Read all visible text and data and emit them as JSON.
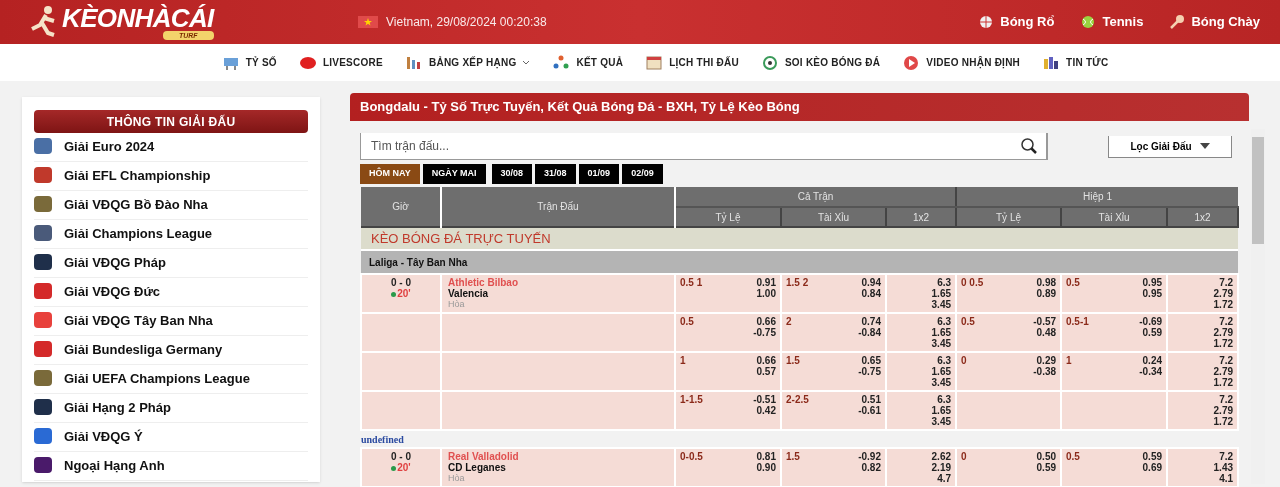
{
  "header": {
    "logo": "KÈONHÀCÁI",
    "logo_badge": "TURF",
    "locale": "Vietnam, 29/08/2024 00:20:38",
    "sports": [
      {
        "label": "Bóng Rổ",
        "kind": "basketball"
      },
      {
        "label": "Tennis",
        "kind": "tennis"
      },
      {
        "label": "Bóng Chày",
        "kind": "baseball"
      }
    ]
  },
  "nav": [
    {
      "label": "TỶ SỐ",
      "kind": "score",
      "dropdown": false
    },
    {
      "label": "LIVESCORE",
      "kind": "live",
      "dropdown": false
    },
    {
      "label": "BẢNG XẾP HẠNG",
      "kind": "ranking",
      "dropdown": true
    },
    {
      "label": "KẾT QUẢ",
      "kind": "result",
      "dropdown": false
    },
    {
      "label": "LỊCH THI ĐẤU",
      "kind": "calendar",
      "dropdown": false
    },
    {
      "label": "SOI KÈO BÓNG ĐÁ",
      "kind": "ball",
      "dropdown": false
    },
    {
      "label": "VIDEO NHẬN ĐỊNH",
      "kind": "video",
      "dropdown": false
    },
    {
      "label": "TIN TỨC",
      "kind": "news",
      "dropdown": false
    }
  ],
  "sidebar": {
    "title": "THÔNG TIN GIẢI ĐẤU",
    "items": [
      {
        "label": "Giải Euro 2024",
        "color": "#4a6fa5"
      },
      {
        "label": "Giải EFL Championship",
        "color": "#c0392b"
      },
      {
        "label": "Giải VĐQG Bồ Đào Nha",
        "color": "#7a6a3a"
      },
      {
        "label": "Giải Champions League",
        "color": "#4a5a7a"
      },
      {
        "label": "Giải VĐQG Pháp",
        "color": "#1f2f4a"
      },
      {
        "label": "Giải VĐQG Đức",
        "color": "#d42a2a"
      },
      {
        "label": "Giải VĐQG Tây Ban Nha",
        "color": "#e8413c"
      },
      {
        "label": "Giải Bundesliga Germany",
        "color": "#d42a2a"
      },
      {
        "label": "Giải UEFA Champions League",
        "color": "#7a6a3a"
      },
      {
        "label": "Giải Hạng 2 Pháp",
        "color": "#1f2f4a"
      },
      {
        "label": "Giải VĐQG Ý",
        "color": "#2a6ad4"
      },
      {
        "label": "Ngoại Hạng Anh",
        "color": "#4a1a6a"
      }
    ]
  },
  "main": {
    "title": "Bongdalu - Tỷ Số Trực Tuyến, Kết Quả Bóng Đá - BXH, Tỷ Lệ Kèo Bóng",
    "search": {
      "placeholder": "Tìm trận đấu..."
    },
    "filter": "Lọc Giải Đấu",
    "date_tabs": [
      {
        "label": "HÔM NAY",
        "selected": true
      },
      {
        "label": "NGÀY MAI",
        "selected": false
      },
      {
        "label": "30/08",
        "selected": false
      },
      {
        "label": "31/08",
        "selected": false
      },
      {
        "label": "01/09",
        "selected": false
      },
      {
        "label": "02/09",
        "selected": false
      }
    ],
    "table": {
      "col_time": "Giờ",
      "col_match": "Trận Đấu",
      "groups": [
        {
          "label": "Cả Trận",
          "columns": [
            "Tỷ Lệ",
            "Tài Xỉu",
            "1x2"
          ]
        },
        {
          "label": "Hiệp 1",
          "columns": [
            "Tỷ Lệ",
            "Tài Xỉu",
            "1x2"
          ]
        }
      ],
      "section": "KÈO BÓNG ĐÁ TRỰC TUYẾN",
      "blocks": [
        {
          "kind": "league",
          "label": "Laliga - Tây Ban Nha"
        },
        {
          "kind": "match",
          "score": "0 - 0",
          "minute": "20'",
          "home": "Athletic Bilbao",
          "away": "Valencia",
          "note": "Hòa",
          "rows": [
            [
              {
                "line": "0.5 1",
                "odds": [
                  "0.91",
                  "1.00"
                ]
              },
              {
                "line": "1.5 2",
                "odds": [
                  "0.94",
                  "0.84"
                ]
              },
              {
                "odds": [
                  "6.3",
                  "1.65",
                  "3.45"
                ]
              },
              {
                "line": "0 0.5",
                "odds": [
                  "0.98",
                  "0.89"
                ]
              },
              {
                "line": "0.5",
                "odds": [
                  "0.95",
                  "0.95"
                ]
              },
              {
                "odds": [
                  "7.2",
                  "2.79",
                  "1.72"
                ]
              }
            ],
            [
              {
                "line": "0.5",
                "odds": [
                  "0.66",
                  "-0.75"
                ]
              },
              {
                "line": "2",
                "odds": [
                  "0.74",
                  "-0.84"
                ]
              },
              {
                "odds": [
                  "6.3",
                  "1.65",
                  "3.45"
                ]
              },
              {
                "line": "0.5",
                "odds": [
                  "-0.57",
                  "0.48"
                ]
              },
              {
                "line": "0.5-1",
                "odds": [
                  "-0.69",
                  "0.59"
                ]
              },
              {
                "odds": [
                  "7.2",
                  "2.79",
                  "1.72"
                ]
              }
            ],
            [
              {
                "line": "1",
                "odds": [
                  "0.66",
                  "0.57"
                ]
              },
              {
                "line": "1.5",
                "odds": [
                  "0.65",
                  "-0.75"
                ]
              },
              {
                "odds": [
                  "6.3",
                  "1.65",
                  "3.45"
                ]
              },
              {
                "line": "0",
                "odds": [
                  "0.29",
                  "-0.38"
                ]
              },
              {
                "line": "1",
                "odds": [
                  "0.24",
                  "-0.34"
                ]
              },
              {
                "odds": [
                  "7.2",
                  "2.79",
                  "1.72"
                ]
              }
            ],
            [
              {
                "line": "1-1.5",
                "odds": [
                  "-0.51",
                  "0.42"
                ]
              },
              {
                "line": "2-2.5",
                "odds": [
                  "0.51",
                  "-0.61"
                ]
              },
              {
                "odds": [
                  "6.3",
                  "1.65",
                  "3.45"
                ]
              },
              {},
              {},
              {
                "odds": [
                  "7.2",
                  "2.79",
                  "1.72"
                ]
              }
            ]
          ]
        },
        {
          "kind": "label",
          "label": "undefined"
        },
        {
          "kind": "match",
          "score": "0 - 0",
          "minute": "20'",
          "home": "Real Valladolid",
          "away": "CD Leganes",
          "note": "Hòa",
          "rows": [
            [
              {
                "line": "0-0.5",
                "odds": [
                  "0.81",
                  "0.90"
                ]
              },
              {
                "line": "1.5",
                "odds": [
                  "-0.92",
                  "0.82"
                ]
              },
              {
                "odds": [
                  "2.62",
                  "2.19",
                  "4.7"
                ]
              },
              {
                "line": "0",
                "odds": [
                  "0.50",
                  "0.59"
                ]
              },
              {
                "line": "0.5",
                "odds": [
                  "0.59",
                  "0.69"
                ]
              },
              {
                "odds": [
                  "7.2",
                  "1.43",
                  "4.1"
                ]
              }
            ]
          ]
        }
      ]
    }
  }
}
